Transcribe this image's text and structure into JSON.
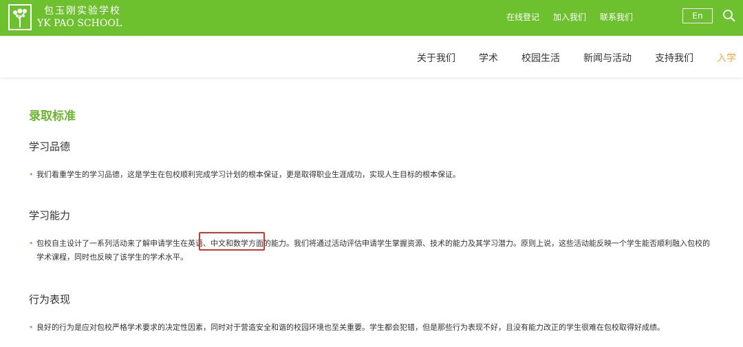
{
  "header": {
    "logo_cn": "包玉刚实验学校",
    "logo_en": "YK PAO SCHOOL",
    "util_links": [
      "在线登记",
      "加入我们",
      "联系我们"
    ],
    "lang_label": "En",
    "brand_color": "#6ec12e"
  },
  "mainnav": {
    "items": [
      "关于我们",
      "学术",
      "校园生活",
      "新闻与活动",
      "支持我们",
      "入学"
    ],
    "active": "入学",
    "active_color": "#f2a93b"
  },
  "content": {
    "title": "录取标准",
    "sections": [
      {
        "heading": "学习品德",
        "bullets": [
          "我们看重学生的学习品德，这是学生在包校顺利完成学习计划的根本保证，更是取得职业生涯成功，实现人生目标的根本保证。"
        ]
      },
      {
        "heading": "学习能力",
        "bullets": [
          "包校自主设计了一系列活动来了解申请学生在英语、中文和数学方面的能力。我们将通过活动评估申请学生掌握资源、技术的能力及其学习潜力。原则上说，这些活动能反映一个学生能否顺利融入包校的学术课程，同时也反映了该学生的学术水平。"
        ],
        "highlighted_text": "英语、中文和数学"
      },
      {
        "heading": "行为表现",
        "bullets": [
          "良好的行为是应对包校严格学术要求的决定性因素，同时对于营造安全和谐的校园环境也至关重要。学生都会犯错，但是那些行为表现不好，且没有能力改正的学生很难在包校取得好成绩。"
        ]
      }
    ]
  },
  "icons": {
    "search": "search-icon",
    "logo": "tree-logo-icon",
    "bullet": "bullet-dot-icon"
  }
}
